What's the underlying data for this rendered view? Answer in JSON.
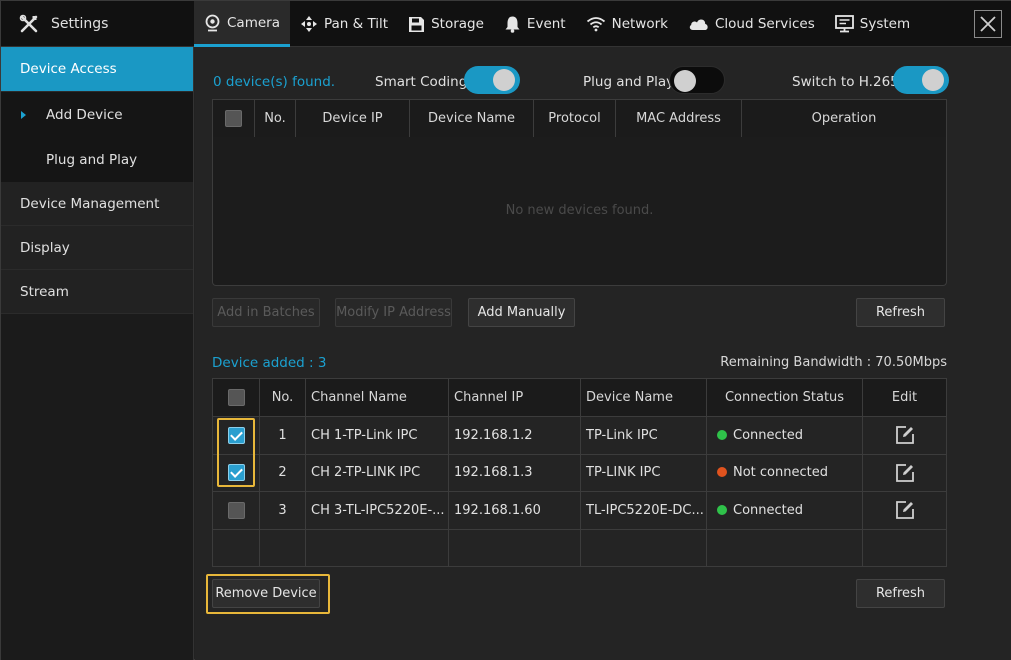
{
  "app": {
    "title": "Settings"
  },
  "tabs": [
    {
      "label": "Camera",
      "icon": "camera-icon",
      "active": true
    },
    {
      "label": "Pan & Tilt",
      "icon": "pan-tilt-icon"
    },
    {
      "label": "Storage",
      "icon": "storage-icon"
    },
    {
      "label": "Event",
      "icon": "bell-icon"
    },
    {
      "label": "Network",
      "icon": "wifi-icon"
    },
    {
      "label": "Cloud Services",
      "icon": "cloud-icon"
    },
    {
      "label": "System",
      "icon": "monitor-icon"
    }
  ],
  "sidebar": {
    "items": [
      {
        "label": "Device Access"
      },
      {
        "label": "Add Device"
      },
      {
        "label": "Plug and Play"
      },
      {
        "label": "Device Management"
      },
      {
        "label": "Display"
      },
      {
        "label": "Stream"
      }
    ]
  },
  "discovery": {
    "found_text": "0 device(s) found.",
    "smart_coding_label": "Smart Coding",
    "smart_coding_on": true,
    "plug_play_label": "Plug and Play",
    "plug_play_on": false,
    "h265_label": "Switch to H.265",
    "h265_on": true,
    "columns": [
      "No.",
      "Device IP",
      "Device Name",
      "Protocol",
      "MAC Address",
      "Operation"
    ],
    "empty_text": "No new devices found.",
    "buttons": {
      "add_batches": "Add in Batches",
      "modify_ip": "Modify IP Address",
      "add_manually": "Add Manually",
      "refresh": "Refresh"
    }
  },
  "added": {
    "label": "Device added : 3",
    "bandwidth": "Remaining Bandwidth : 70.50Mbps",
    "columns": [
      "No.",
      "Channel Name",
      "Channel IP",
      "Device Name",
      "Connection Status",
      "Edit"
    ],
    "rows": [
      {
        "checked": true,
        "no": "1",
        "channel_name": "CH 1-TP-Link IPC",
        "channel_ip": "192.168.1.2",
        "device_name": "TP-Link IPC",
        "status": "Connected"
      },
      {
        "checked": true,
        "no": "2",
        "channel_name": "CH 2-TP-LINK IPC",
        "channel_ip": "192.168.1.3",
        "device_name": "TP-LINK IPC",
        "status": "Not connected"
      },
      {
        "checked": false,
        "no": "3",
        "channel_name": "CH 3-TL-IPC5220E-...",
        "channel_ip": "192.168.1.60",
        "device_name": "TL-IPC5220E-DC...",
        "status": "Connected"
      }
    ],
    "buttons": {
      "remove": "Remove Device",
      "refresh": "Refresh"
    }
  },
  "colors": {
    "accent": "#1a98c4",
    "connected": "#2fc24a",
    "not_connected": "#e0531e",
    "highlight": "#e8b73a"
  }
}
